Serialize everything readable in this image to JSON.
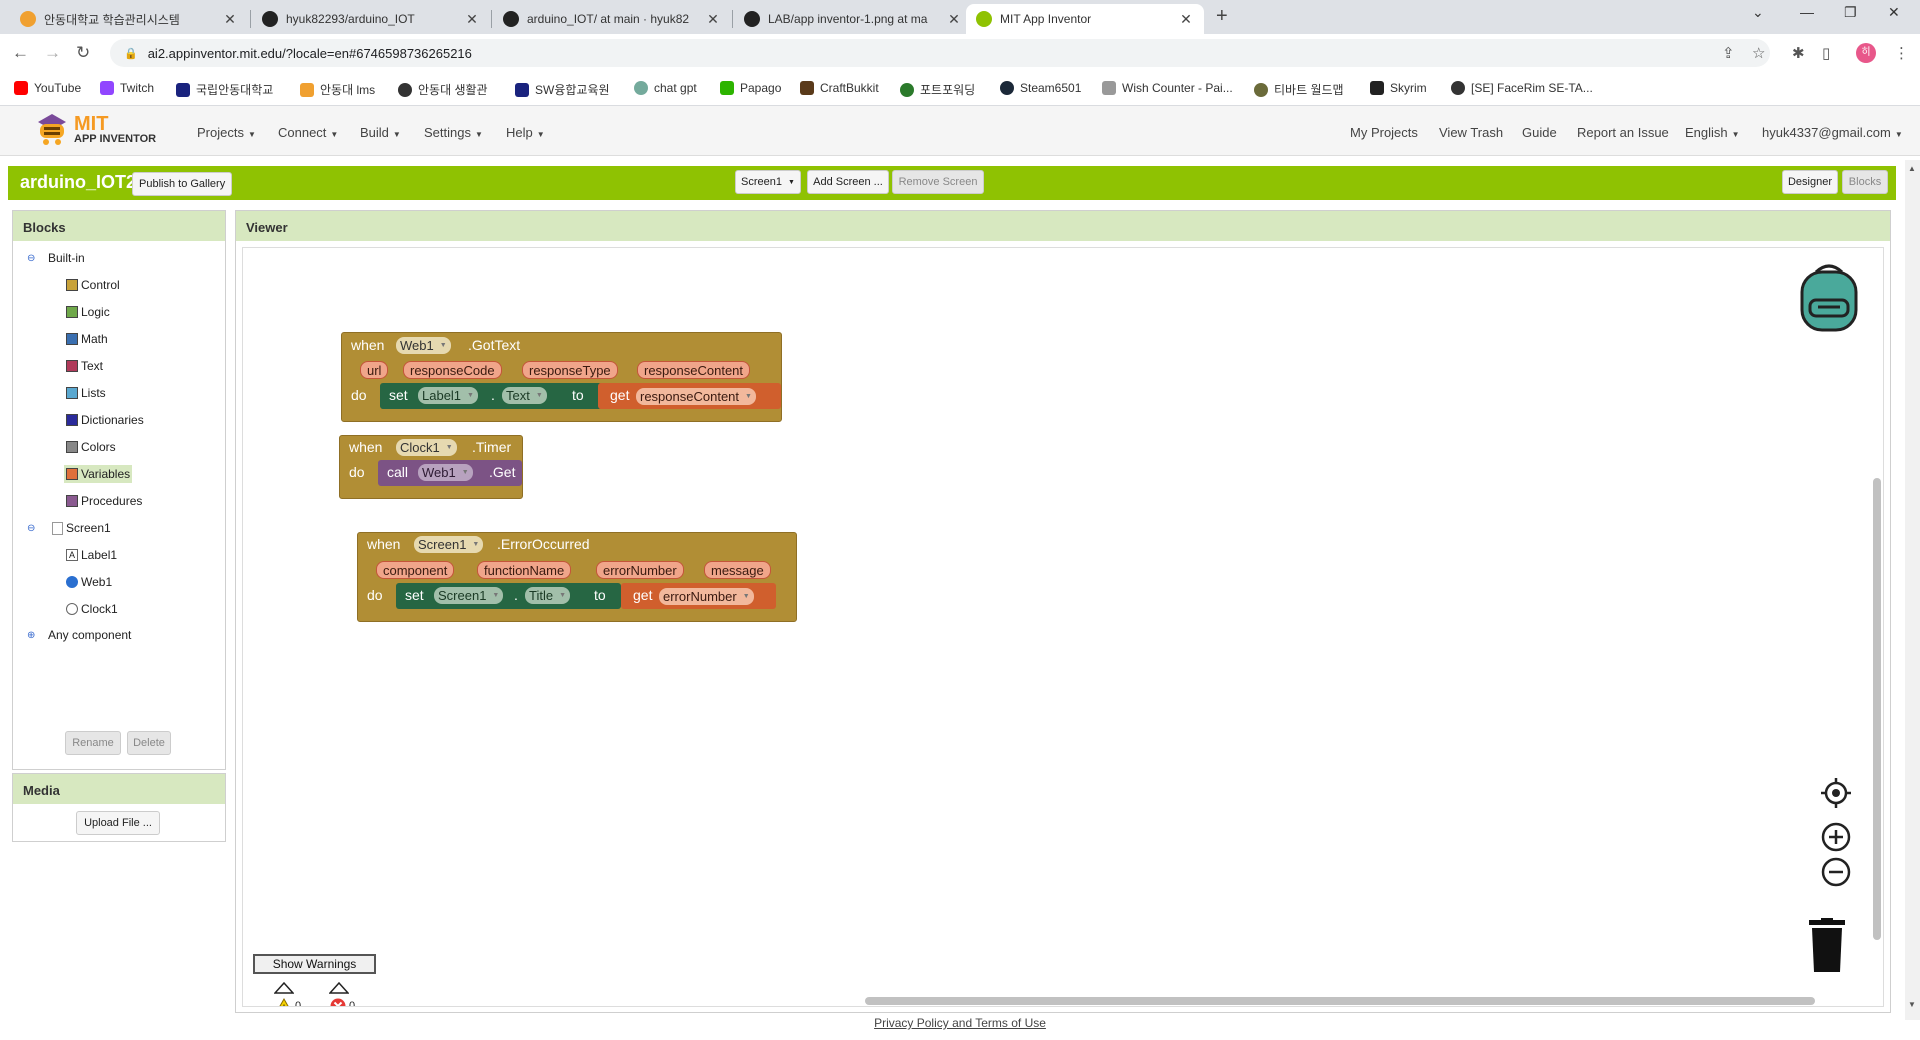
{
  "browser": {
    "tabs": [
      {
        "title": "안동대학교 학습관리시스템",
        "color": "#f0a030"
      },
      {
        "title": "hyuk82293/arduino_IOT",
        "color": "#222222"
      },
      {
        "title": "arduino_IOT/ at main · hyuk82",
        "color": "#222222"
      },
      {
        "title": "LAB/app inventor-1.png at ma",
        "color": "#222222"
      },
      {
        "title": "MIT App Inventor",
        "color": "#8fc202"
      }
    ],
    "url": "ai2.appinventor.mit.edu/?locale=en#6746598736265216",
    "profile_initial": "히",
    "bookmarks": [
      {
        "label": "YouTube",
        "color": "#ff0000"
      },
      {
        "label": "Twitch",
        "color": "#9146ff"
      },
      {
        "label": "국립안동대학교",
        "color": "#1a237e"
      },
      {
        "label": "안동대 lms",
        "color": "#f0a030"
      },
      {
        "label": "안동대 생활관",
        "color": "#333333"
      },
      {
        "label": "SW융합교육원",
        "color": "#1a237e"
      },
      {
        "label": "chat gpt",
        "color": "#74aa9c"
      },
      {
        "label": "Papago",
        "color": "#2db400"
      },
      {
        "label": "CraftBukkit",
        "color": "#5a3a1a"
      },
      {
        "label": "포트포워딩",
        "color": "#2b7a2b"
      },
      {
        "label": "Steam6501",
        "color": "#1b2838"
      },
      {
        "label": "Wish Counter - Pai...",
        "color": "#999999"
      },
      {
        "label": "티바트 월드맵",
        "color": "#6b6b3a"
      },
      {
        "label": "Skyrim",
        "color": "#222222"
      },
      {
        "label": "[SE] FaceRim SE-TA...",
        "color": "#333333"
      }
    ]
  },
  "header": {
    "logo_top": "MIT",
    "logo_bottom": "APP INVENTOR",
    "left_menus": [
      "Projects",
      "Connect",
      "Build",
      "Settings",
      "Help"
    ],
    "right_menus": [
      "My Projects",
      "View Trash",
      "Guide",
      "Report an Issue",
      "English",
      "hyuk4337@gmail.com"
    ]
  },
  "project": {
    "name": "arduino_IOT2",
    "publish_label": "Publish to Gallery",
    "screen_select": "Screen1",
    "add_screen": "Add Screen ...",
    "remove_screen": "Remove Screen",
    "designer": "Designer",
    "blocks": "Blocks"
  },
  "blocks_panel": {
    "title": "Blocks",
    "builtin": "Built-in",
    "builtin_items": [
      {
        "label": "Control",
        "color": "#c8a23a"
      },
      {
        "label": "Logic",
        "color": "#6fa84a"
      },
      {
        "label": "Math",
        "color": "#3a6fb0"
      },
      {
        "label": "Text",
        "color": "#b03a5a"
      },
      {
        "label": "Lists",
        "color": "#5aa8d0"
      },
      {
        "label": "Dictionaries",
        "color": "#2a2a9a"
      },
      {
        "label": "Colors",
        "color": "#888888"
      },
      {
        "label": "Variables",
        "color": "#e0703a"
      },
      {
        "label": "Procedures",
        "color": "#8a5a90"
      }
    ],
    "screen": "Screen1",
    "components": [
      "Label1",
      "Web1",
      "Clock1"
    ],
    "any_component": "Any component",
    "rename": "Rename",
    "delete": "Delete"
  },
  "media_panel": {
    "title": "Media",
    "upload": "Upload File ..."
  },
  "viewer": {
    "title": "Viewer",
    "warnings_count": "0",
    "errors_count": "0",
    "show_warnings": "Show Warnings"
  },
  "block1": {
    "when": "when",
    "component": "Web1",
    "event": ".GotText",
    "params": [
      "url",
      "responseCode",
      "responseType",
      "responseContent"
    ],
    "do": "do",
    "set": "set",
    "set_component": "Label1",
    "dot": ".",
    "property": "Text",
    "to": "to",
    "get": "get",
    "get_var": "responseContent"
  },
  "block2": {
    "when": "when",
    "component": "Clock1",
    "event": ".Timer",
    "do": "do",
    "call": "call",
    "call_component": "Web1",
    "method": ".Get"
  },
  "block3": {
    "when": "when",
    "component": "Screen1",
    "event": ".ErrorOccurred",
    "params": [
      "component",
      "functionName",
      "errorNumber",
      "message"
    ],
    "do": "do",
    "set": "set",
    "set_component": "Screen1",
    "dot": ".",
    "property": "Title",
    "to": "to",
    "get": "get",
    "get_var": "errorNumber"
  },
  "footer": {
    "privacy": "Privacy Policy and Terms of Use"
  }
}
